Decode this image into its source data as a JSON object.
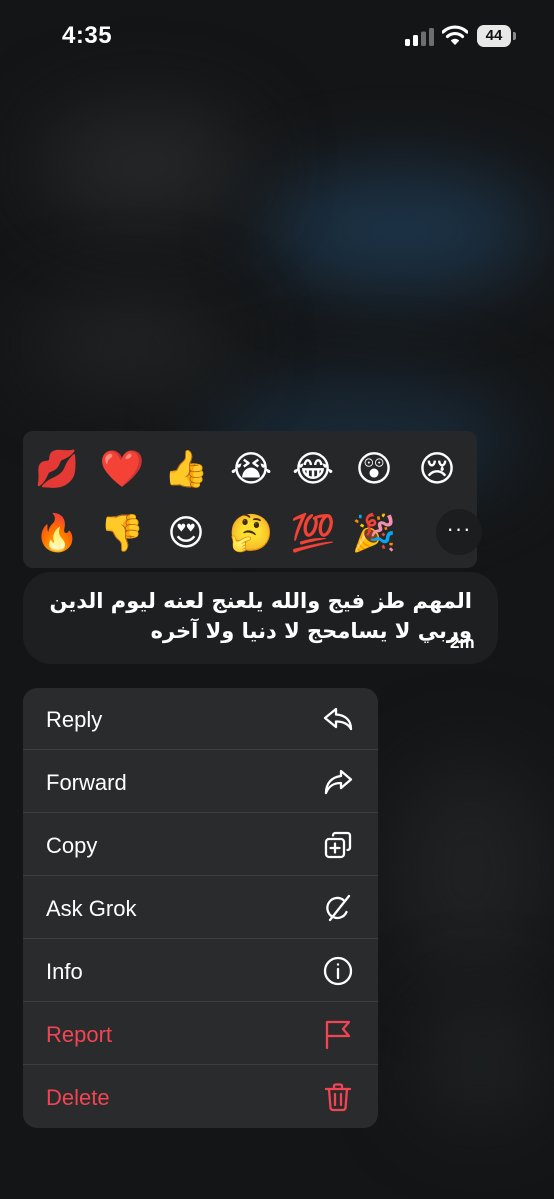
{
  "status_bar": {
    "time": "4:35",
    "battery": "44"
  },
  "reactions": {
    "row1": [
      "💋",
      "❤️",
      "👍",
      "😭",
      "😂",
      "😲",
      "😢"
    ],
    "row2": [
      "🔥",
      "👎",
      "😍",
      "🤔",
      "💯",
      "🎉"
    ],
    "more_label": "···"
  },
  "message": {
    "line1": "المهم طز فيج والله يلعنج لعنه ليوم الدين",
    "line2": "وربي لا يسامحج لا دنيا ولا آخره",
    "time": "2m"
  },
  "menu": {
    "items": [
      {
        "label": "Reply",
        "icon": "reply-icon"
      },
      {
        "label": "Forward",
        "icon": "forward-icon"
      },
      {
        "label": "Copy",
        "icon": "copy-icon"
      },
      {
        "label": "Ask Grok",
        "icon": "grok-icon"
      },
      {
        "label": "Info",
        "icon": "info-icon"
      },
      {
        "label": "Report",
        "icon": "flag-icon"
      },
      {
        "label": "Delete",
        "icon": "trash-icon"
      }
    ]
  },
  "colors": {
    "danger": "#f24453",
    "menu_bg": "#2a2b2c",
    "bubble_bg": "#1e1f20"
  }
}
